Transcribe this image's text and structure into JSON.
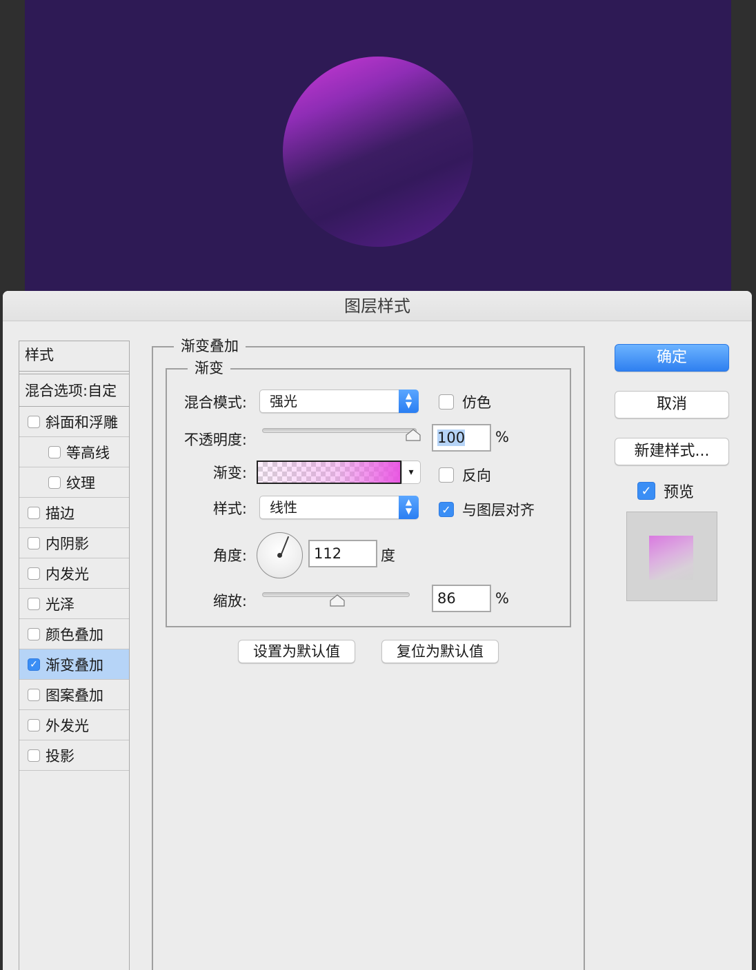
{
  "dialog": {
    "title": "图层样式"
  },
  "styles_panel": {
    "header": "样式",
    "blend_options": "混合选项:自定",
    "items": [
      {
        "label": "斜面和浮雕",
        "checked": false,
        "indent": false
      },
      {
        "label": "等高线",
        "checked": false,
        "indent": true
      },
      {
        "label": "纹理",
        "checked": false,
        "indent": true
      },
      {
        "label": "描边",
        "checked": false,
        "indent": false
      },
      {
        "label": "内阴影",
        "checked": false,
        "indent": false
      },
      {
        "label": "内发光",
        "checked": false,
        "indent": false
      },
      {
        "label": "光泽",
        "checked": false,
        "indent": false
      },
      {
        "label": "颜色叠加",
        "checked": false,
        "indent": false
      },
      {
        "label": "渐变叠加",
        "checked": true,
        "indent": false,
        "selected": true
      },
      {
        "label": "图案叠加",
        "checked": false,
        "indent": false
      },
      {
        "label": "外发光",
        "checked": false,
        "indent": false
      },
      {
        "label": "投影",
        "checked": false,
        "indent": false
      }
    ]
  },
  "gradient_overlay": {
    "section_title": "渐变叠加",
    "subsection_title": "渐变",
    "blend_mode_label": "混合模式:",
    "blend_mode_value": "强光",
    "dither_label": "仿色",
    "dither_checked": false,
    "opacity_label": "不透明度:",
    "opacity_value": "100",
    "opacity_level": 1.0,
    "opacity_unit": "%",
    "gradient_label": "渐变:",
    "reverse_label": "反向",
    "reverse_checked": false,
    "style_label": "样式:",
    "style_value": "线性",
    "align_label": "与图层对齐",
    "align_checked": true,
    "angle_label": "角度:",
    "angle_value": "112",
    "angle_unit": "度",
    "scale_label": "缩放:",
    "scale_value": "86",
    "scale_level": 0.5,
    "scale_unit": "%",
    "set_default_button": "设置为默认值",
    "reset_default_button": "复位为默认值"
  },
  "actions": {
    "ok": "确定",
    "cancel": "取消",
    "new_style": "新建样式...",
    "preview_label": "预览",
    "preview_checked": true
  },
  "colors": {
    "canvas_bg": "#2e1a55",
    "sphere_light": "#cf3ad8",
    "accent": "#3a8ef5",
    "selected_row": "#b6d4f7"
  }
}
